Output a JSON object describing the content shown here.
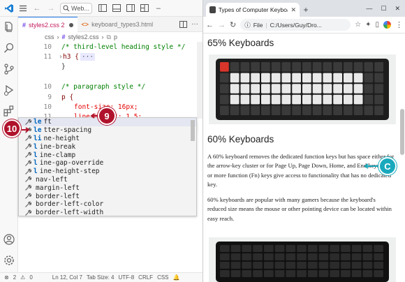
{
  "vscode": {
    "search_label": "Web...",
    "tabs": [
      {
        "label": "styles2.css 2",
        "active": true
      },
      {
        "label": "keyboard_types3.html",
        "active": false
      }
    ],
    "breadcrumb": [
      "css",
      "styles2.css",
      "p"
    ],
    "code_lines": [
      {
        "num": "10",
        "text": "/* third-level heading style */"
      },
      {
        "num": "11",
        "text": "h3 {"
      },
      {
        "num": "",
        "text": "}"
      },
      {
        "num": "10",
        "text": "/* paragraph style */"
      },
      {
        "num": "9",
        "text": "p {"
      },
      {
        "num": "10",
        "text": "font-size: 16px;"
      },
      {
        "num": "11",
        "text": "line-height: 1.5;"
      },
      {
        "num": "12",
        "text": "le"
      }
    ],
    "suggestions": [
      {
        "bold": "le",
        "rest": "ft"
      },
      {
        "bold": "le",
        "rest": "tter-spacing"
      },
      {
        "bold": "li",
        "rest": "ne-height"
      },
      {
        "bold": "l",
        "rest": "ine-break"
      },
      {
        "bold": "l",
        "rest": "ine-clamp"
      },
      {
        "bold": "l",
        "rest": "ine-gap-override"
      },
      {
        "bold": "l",
        "rest": "ine-height-step"
      },
      {
        "bold": "",
        "rest": "nav-left"
      },
      {
        "bold": "",
        "rest": "margin-left"
      },
      {
        "bold": "",
        "rest": "border-left"
      },
      {
        "bold": "",
        "rest": "border-left-color"
      },
      {
        "bold": "",
        "rest": "border-left-width"
      }
    ],
    "status": {
      "errors": "2",
      "warnings": "0",
      "position": "Ln 12, Col 7",
      "tab_size": "Tab Size: 4",
      "encoding": "UTF-8",
      "eol": "CRLF",
      "language": "CSS"
    }
  },
  "browser": {
    "tab_title": "Types of Computer Keyboards",
    "address_label": "File",
    "address": "C:/Users/Guy/Dro...",
    "heading1": "65% Keyboards",
    "heading2": "60% Keyboards",
    "para1": "A 60% keyboard removes the dedicated function keys but has space either for the arrow-key cluster or for Page Up, Page Down, Home, and End keys. One or more function (Fn) keys give access to functionality that has no dedicated key.",
    "para2": "60% keyboards are popular with many gamers because the keyboard's reduced size means the mouse or other pointing device can be located within easy reach."
  },
  "callouts": {
    "step10": "10",
    "step9": "9",
    "stepC": "C"
  },
  "colors": {
    "callout_red": "#b0122b",
    "callout_teal": "#19a9bd",
    "accent_blue": "#1a73e8"
  }
}
